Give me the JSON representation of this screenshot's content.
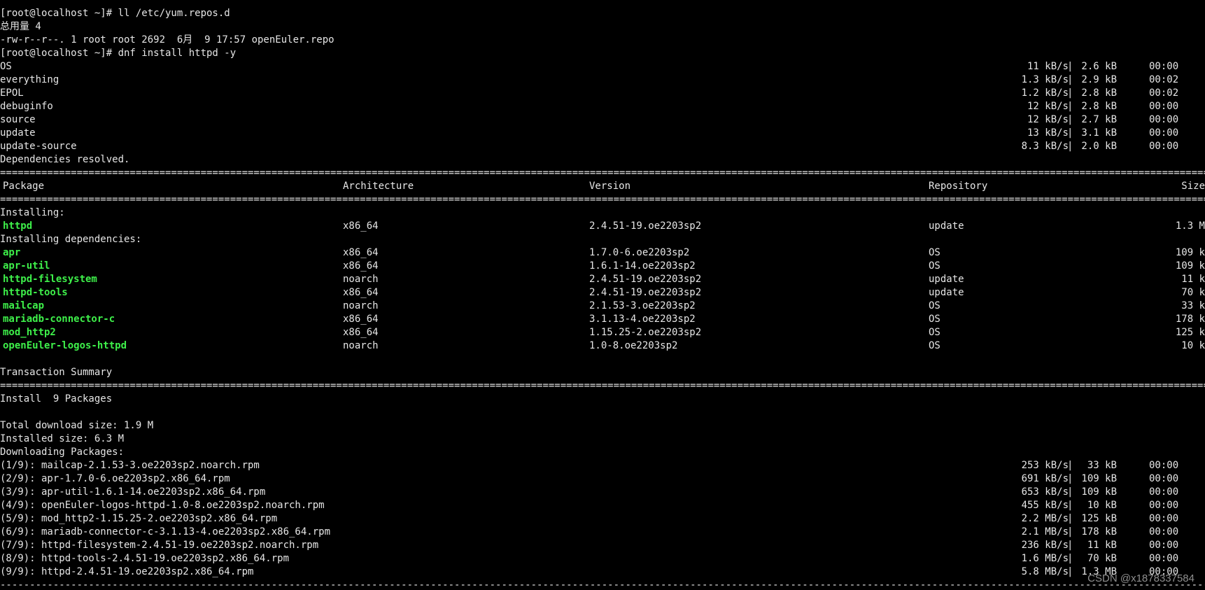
{
  "colors": {
    "background": "#000000",
    "text": "#e6e6e6",
    "package_name": "#3ef04a"
  },
  "prompt_lines": [
    "[root@localhost ~]# ll /etc/yum.repos.d",
    "总用量 4",
    "-rw-r--r--. 1 root root 2692  6月  9 17:57 openEuler.repo",
    "[root@localhost ~]# dnf install httpd -y"
  ],
  "repo_sync": [
    {
      "name": "OS",
      "rate": "11 kB/s",
      "sep": "|",
      "size": "2.6 kB",
      "time": "00:00"
    },
    {
      "name": "everything",
      "rate": "1.3 kB/s",
      "sep": "|",
      "size": "2.9 kB",
      "time": "00:02"
    },
    {
      "name": "EPOL",
      "rate": "1.2 kB/s",
      "sep": "|",
      "size": "2.8 kB",
      "time": "00:02"
    },
    {
      "name": "debuginfo",
      "rate": "12 kB/s",
      "sep": "|",
      "size": "2.8 kB",
      "time": "00:00"
    },
    {
      "name": "source",
      "rate": "12 kB/s",
      "sep": "|",
      "size": "2.7 kB",
      "time": "00:00"
    },
    {
      "name": "update",
      "rate": "13 kB/s",
      "sep": "|",
      "size": "3.1 kB",
      "time": "00:00"
    },
    {
      "name": "update-source",
      "rate": "8.3 kB/s",
      "sep": "|",
      "size": "2.0 kB",
      "time": "00:00"
    }
  ],
  "deps_resolved": "Dependencies resolved.",
  "rule_double": "================================================================================================================================================================================================================================",
  "rule_dashed": "--------------------------------------------------------------------------------------------------------------------------------------------------------------------------------------------------------------------------------",
  "table_header": {
    "package": "Package",
    "architecture": "Architecture",
    "version": "Version",
    "repository": "Repository",
    "size": "Size"
  },
  "installing_label": "Installing:",
  "installing": [
    {
      "name": "httpd",
      "arch": "x86_64",
      "version": "2.4.51-19.oe2203sp2",
      "repo": "update",
      "size": "1.3 M"
    }
  ],
  "deps_label": "Installing dependencies:",
  "dependencies": [
    {
      "name": "apr",
      "arch": "x86_64",
      "version": "1.7.0-6.oe2203sp2",
      "repo": "OS",
      "size": "109 k"
    },
    {
      "name": "apr-util",
      "arch": "x86_64",
      "version": "1.6.1-14.oe2203sp2",
      "repo": "OS",
      "size": "109 k"
    },
    {
      "name": "httpd-filesystem",
      "arch": "noarch",
      "version": "2.4.51-19.oe2203sp2",
      "repo": "update",
      "size": "11 k"
    },
    {
      "name": "httpd-tools",
      "arch": "x86_64",
      "version": "2.4.51-19.oe2203sp2",
      "repo": "update",
      "size": "70 k"
    },
    {
      "name": "mailcap",
      "arch": "noarch",
      "version": "2.1.53-3.oe2203sp2",
      "repo": "OS",
      "size": "33 k"
    },
    {
      "name": "mariadb-connector-c",
      "arch": "x86_64",
      "version": "3.1.13-4.oe2203sp2",
      "repo": "OS",
      "size": "178 k"
    },
    {
      "name": "mod_http2",
      "arch": "x86_64",
      "version": "1.15.25-2.oe2203sp2",
      "repo": "OS",
      "size": "125 k"
    },
    {
      "name": "openEuler-logos-httpd",
      "arch": "noarch",
      "version": "1.0-8.oe2203sp2",
      "repo": "OS",
      "size": "10 k"
    }
  ],
  "transaction_summary": "Transaction Summary",
  "install_count": "Install  9 Packages",
  "total_download": "Total download size: 1.9 M",
  "installed_size": "Installed size: 6.3 M",
  "downloading_label": "Downloading Packages:",
  "downloads": [
    {
      "name": "(1/9): mailcap-2.1.53-3.oe2203sp2.noarch.rpm",
      "rate": "253 kB/s",
      "sep": "|",
      "size": "33 kB",
      "time": "00:00"
    },
    {
      "name": "(2/9): apr-1.7.0-6.oe2203sp2.x86_64.rpm",
      "rate": "691 kB/s",
      "sep": "|",
      "size": "109 kB",
      "time": "00:00"
    },
    {
      "name": "(3/9): apr-util-1.6.1-14.oe2203sp2.x86_64.rpm",
      "rate": "653 kB/s",
      "sep": "|",
      "size": "109 kB",
      "time": "00:00"
    },
    {
      "name": "(4/9): openEuler-logos-httpd-1.0-8.oe2203sp2.noarch.rpm",
      "rate": "455 kB/s",
      "sep": "|",
      "size": "10 kB",
      "time": "00:00"
    },
    {
      "name": "(5/9): mod_http2-1.15.25-2.oe2203sp2.x86_64.rpm",
      "rate": "2.2 MB/s",
      "sep": "|",
      "size": "125 kB",
      "time": "00:00"
    },
    {
      "name": "(6/9): mariadb-connector-c-3.1.13-4.oe2203sp2.x86_64.rpm",
      "rate": "2.1 MB/s",
      "sep": "|",
      "size": "178 kB",
      "time": "00:00"
    },
    {
      "name": "(7/9): httpd-filesystem-2.4.51-19.oe2203sp2.noarch.rpm",
      "rate": "236 kB/s",
      "sep": "|",
      "size": "11 kB",
      "time": "00:00"
    },
    {
      "name": "(8/9): httpd-tools-2.4.51-19.oe2203sp2.x86_64.rpm",
      "rate": "1.6 MB/s",
      "sep": "|",
      "size": "70 kB",
      "time": "00:00"
    },
    {
      "name": "(9/9): httpd-2.4.51-19.oe2203sp2.x86_64.rpm",
      "rate": "5.8 MB/s",
      "sep": "|",
      "size": "1.3 MB",
      "time": "00:00"
    }
  ],
  "watermark": "CSDN @x1878337584"
}
